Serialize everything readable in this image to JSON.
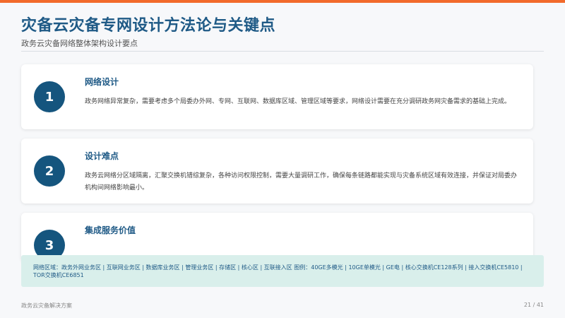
{
  "header": {
    "title": "灾备云灾备专网设计方法论与关键点",
    "subtitle": "政务云灾备网络整体架构设计要点"
  },
  "cards": [
    {
      "number": "1",
      "title": "网络设计",
      "description": "政务网络异常复杂，需要考虑多个局委办外网、专网、互联网、数据库区域、管理区域等要求，网络设计需要在充分调研政务网灾备需求的基础上完成。"
    },
    {
      "number": "2",
      "title": "设计难点",
      "description": "政务云网络分区域隔离，汇聚交换机错综复杂，各种访问权限控制，需要大量调研工作，确保每条链路都能实现与灾备系统区域有效连接，并保证对局委办机构间网络影响最小。"
    },
    {
      "number": "3",
      "title": "集成服务价值"
    }
  ],
  "info_box": {
    "text": "网络区域：政务外网业务区 | 互联网业务区 | 数据库业务区 | 管理业务区 | 存储区 | 核心区 | 互联接入区 图例：40GE多模光 | 10GE单模光 | GE电 | 核心交换机CE128系列 | 接入交换机CE5810 | TOR交换机CE6851"
  },
  "footer": {
    "left": "政务云灾备解决方案",
    "page": "21 / 41"
  },
  "colors": {
    "accent_bar": "#f26a2b",
    "title": "#1f5a86",
    "number_circle": "#15557e",
    "info_box_bg": "#d9efeb"
  }
}
